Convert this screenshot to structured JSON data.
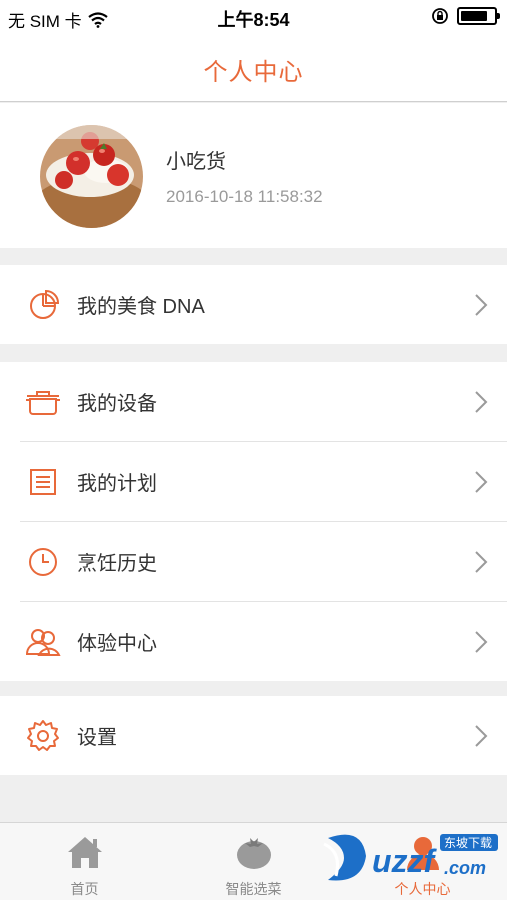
{
  "status_bar": {
    "carrier": "无 SIM 卡",
    "time": "上午8:54",
    "battery_level": 0.8
  },
  "navbar": {
    "title": "个人中心"
  },
  "profile": {
    "name": "小吃货",
    "date": "2016-10-18 11:58:32"
  },
  "menu": {
    "dna": "我的美食 DNA",
    "devices": "我的设备",
    "plan": "我的计划",
    "history": "烹饪历史",
    "experience": "体验中心",
    "settings": "设置"
  },
  "tabs": [
    {
      "label": "首页",
      "icon": "home-icon"
    },
    {
      "label": "智能选菜",
      "icon": "tomato-icon"
    },
    {
      "label": "个人中心",
      "icon": "person-icon",
      "active": true
    }
  ],
  "watermark": {
    "text": "uzzf.com",
    "sub": "东坡下载"
  },
  "colors": {
    "accent": "#e8693a",
    "background": "#efefef",
    "muted": "#9a9a9a"
  }
}
